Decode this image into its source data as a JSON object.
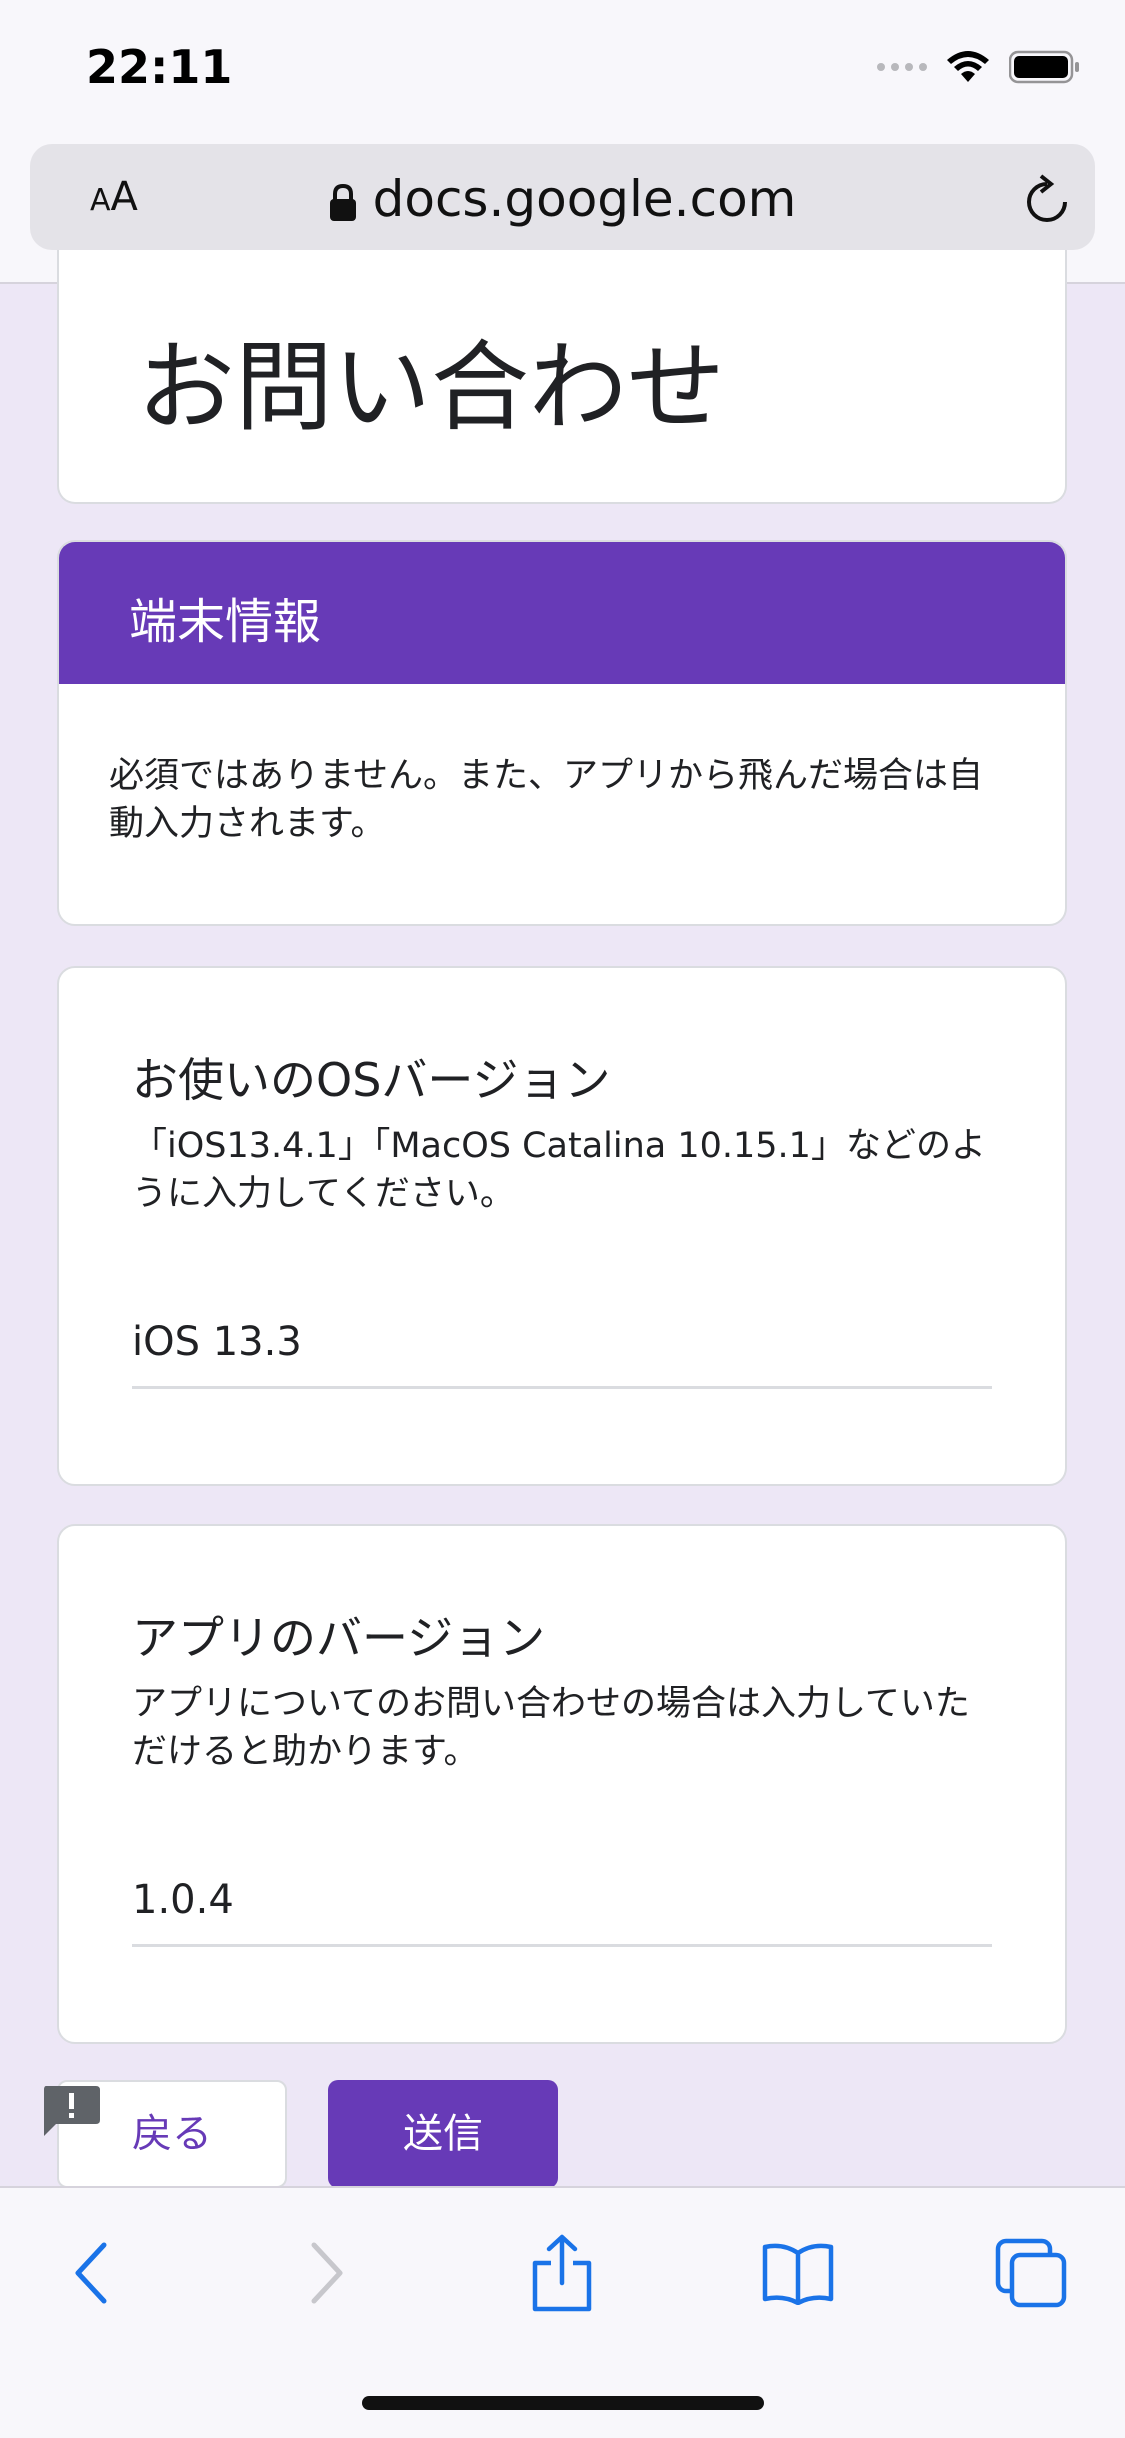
{
  "status_bar": {
    "time": "22:11"
  },
  "browser": {
    "text_size_label_small": "A",
    "text_size_label_large": "A",
    "url": "docs.google.com"
  },
  "form": {
    "title": "お問い合わせ",
    "section": {
      "title": "端末情報",
      "description": "必須ではありません。また、アプリから飛んだ場合は自動入力されます。"
    },
    "questions": [
      {
        "title": "お使いのOSバージョン",
        "help": "「iOS13.4.1」「MacOS Catalina 10.15.1」などのように入力してください。",
        "value": "iOS 13.3"
      },
      {
        "title": "アプリのバージョン",
        "help": "アプリについてのお問い合わせの場合は入力していただけると助かります。",
        "value": "1.0.4"
      }
    ],
    "back_label": "戻る",
    "submit_label": "送信"
  },
  "colors": {
    "accent": "#673ab7",
    "page_background": "#ede7f6",
    "ios_blue": "#1a73e8"
  },
  "icons": [
    "wifi-icon",
    "battery-icon",
    "lock-icon",
    "reload-icon",
    "back-arrow-icon",
    "forward-arrow-icon",
    "share-icon",
    "bookmarks-icon",
    "tabs-icon",
    "report-problem-icon"
  ]
}
